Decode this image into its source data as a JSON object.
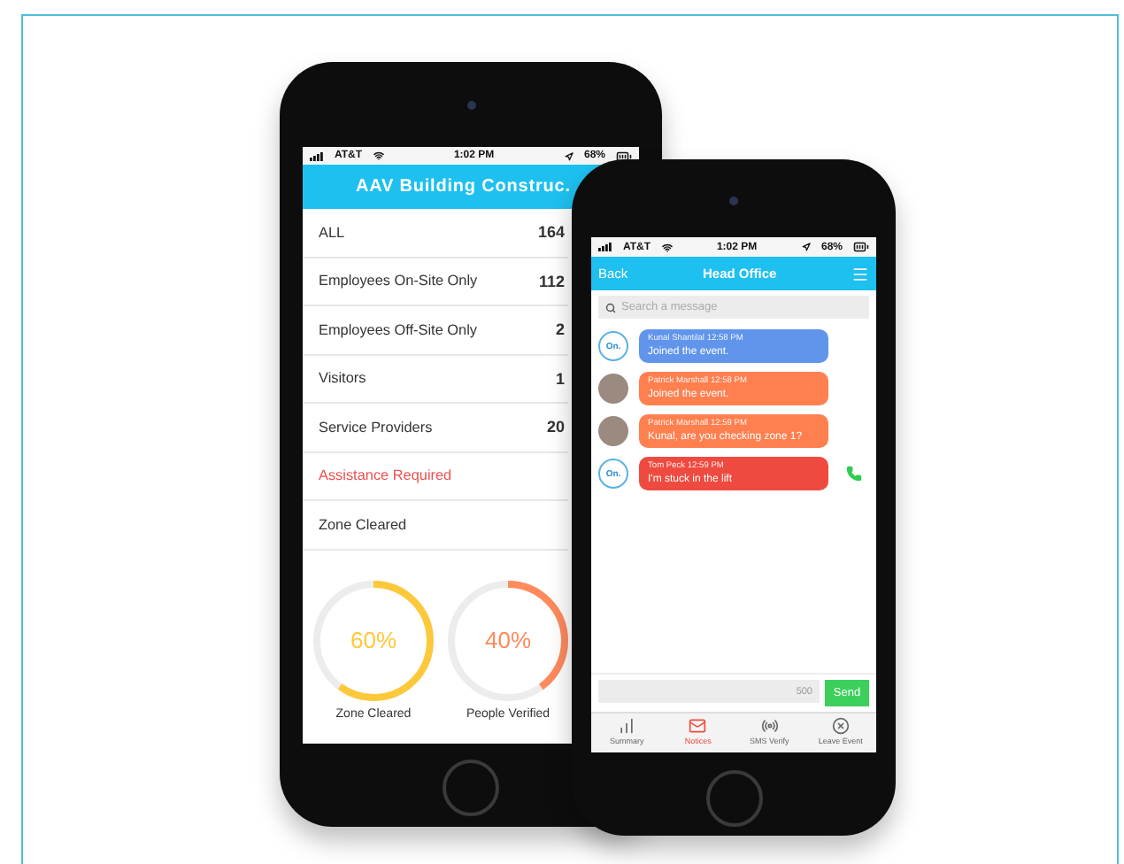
{
  "phone_left": {
    "status_bar": {
      "carrier": "AT&T",
      "time": "1:02 PM",
      "battery": "68%"
    },
    "title": "AAV Building Construc.",
    "rows": [
      {
        "label": "ALL",
        "count": "164",
        "alert": false
      },
      {
        "label": "Employees On-Site Only",
        "count": "112",
        "alert": false
      },
      {
        "label": "Employees Off-Site Only",
        "count": "2",
        "alert": false
      },
      {
        "label": "Visitors",
        "count": "1",
        "alert": false
      },
      {
        "label": "Service Providers",
        "count": "20",
        "alert": false
      },
      {
        "label": "Assistance Required",
        "alert": true
      },
      {
        "label": "Zone Cleared",
        "alert": false
      }
    ],
    "meters": [
      {
        "reading": "60%",
        "label": "Zone Cleared",
        "level": 0.6,
        "color": "#fdc93a"
      },
      {
        "reading": "40%",
        "label": "People Verified",
        "level": 0.4,
        "color": "#ff8a5c"
      }
    ]
  },
  "phone_right": {
    "status_bar": {
      "carrier": "AT&T",
      "time": "1:02 PM",
      "battery": "68%"
    },
    "header": {
      "back": "Back",
      "title": "Head Office"
    },
    "search": {
      "placeholder": "Search a message"
    },
    "messages": [
      {
        "kind": "logo",
        "avatar_text": "On.",
        "sender": "Kunal Shantilal 12:58 PM",
        "text": "Joined the event.",
        "color": "#6195ec",
        "call": false
      },
      {
        "kind": "photo",
        "sender": "Patrick Marshall 12:58 PM",
        "text": "Joined the event.",
        "color": "#ff7f4f",
        "call": false
      },
      {
        "kind": "photo",
        "sender": "Patrick Marshall 12:59 PM",
        "text": "Kunal, are you checking zone 1?",
        "color": "#ff7f4f",
        "call": false
      },
      {
        "kind": "logo",
        "avatar_text": "On.",
        "sender": "Tom Peck 12:59 PM",
        "text": "I'm stuck in the lift",
        "color": "#ef4a3f",
        "call": true
      }
    ],
    "composer": {
      "counter": "500",
      "send": "Send"
    },
    "tabs": [
      {
        "label": "Summary",
        "selected": false
      },
      {
        "label": "Notices",
        "selected": true
      },
      {
        "label": "SMS Verify",
        "selected": false
      },
      {
        "label": "Leave Event",
        "selected": false
      }
    ]
  }
}
